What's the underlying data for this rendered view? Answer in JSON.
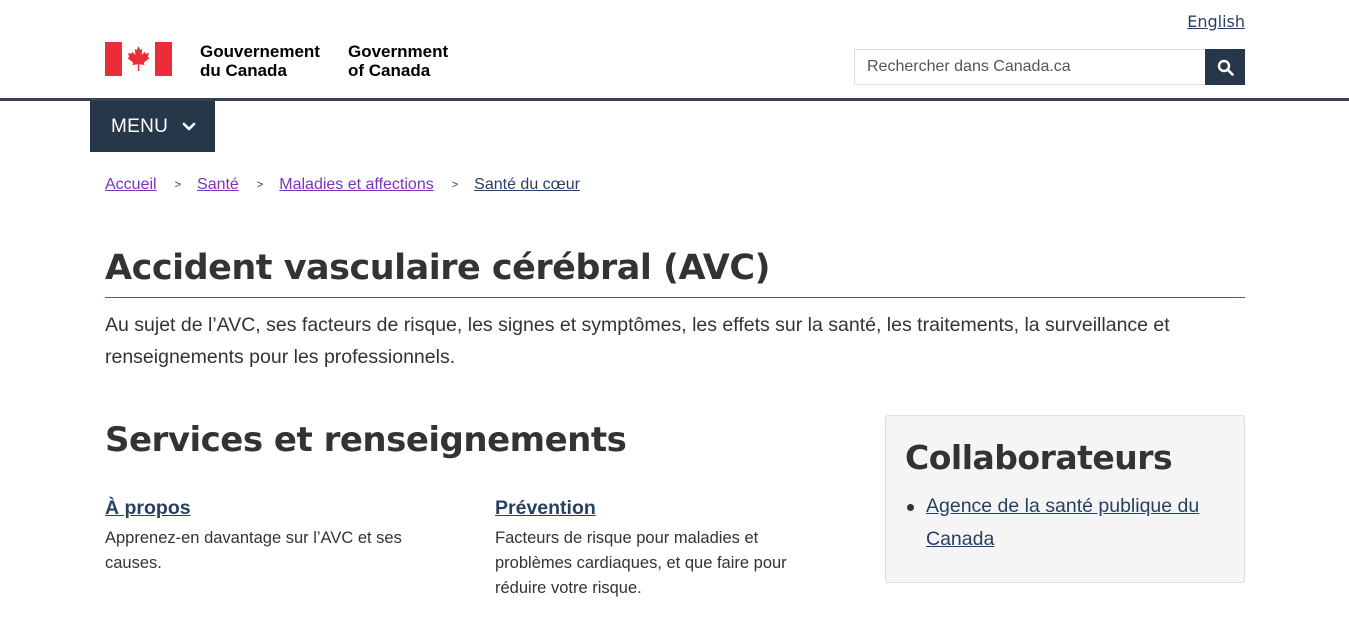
{
  "header": {
    "language_link": "English",
    "fip_fr_line1": "Gouvernement",
    "fip_fr_line2": "du Canada",
    "fip_en_line1": "Government",
    "fip_en_line2": "of Canada",
    "search_placeholder": "Rechercher dans Canada.ca",
    "search_button_icon": "search-icon",
    "flag_color": "#eb2d37"
  },
  "menu": {
    "label": "MENU",
    "icon": "chevron-down-icon"
  },
  "breadcrumb": {
    "items": [
      {
        "label": "Accueil"
      },
      {
        "label": "Santé"
      },
      {
        "label": "Maladies et affections"
      },
      {
        "label": "Santé du cœur"
      }
    ],
    "separator": ">"
  },
  "main": {
    "title": "Accident vasculaire cérébral (AVC)",
    "intro": "Au sujet de l’AVC, ses facteurs de risque, les signes et symptômes, les effets sur la santé, les traitements, la surveillance et renseignements pour les professionnels.",
    "services_title": "Services et renseignements",
    "services": [
      {
        "title": "À propos",
        "description": "Apprenez-en davantage sur l’AVC et ses causes."
      },
      {
        "title": "Prévention",
        "description": "Facteurs de risque pour maladies et problèmes cardiaques, et que faire pour réduire votre risque."
      }
    ]
  },
  "collaborators": {
    "title": "Collaborateurs",
    "items": [
      {
        "label": "Agence de la santé publique du Canada"
      }
    ]
  },
  "colors": {
    "dark_blue": "#26374a",
    "link": "#284162",
    "visited_link": "#7834bc",
    "title_rule": "#af3c43"
  }
}
